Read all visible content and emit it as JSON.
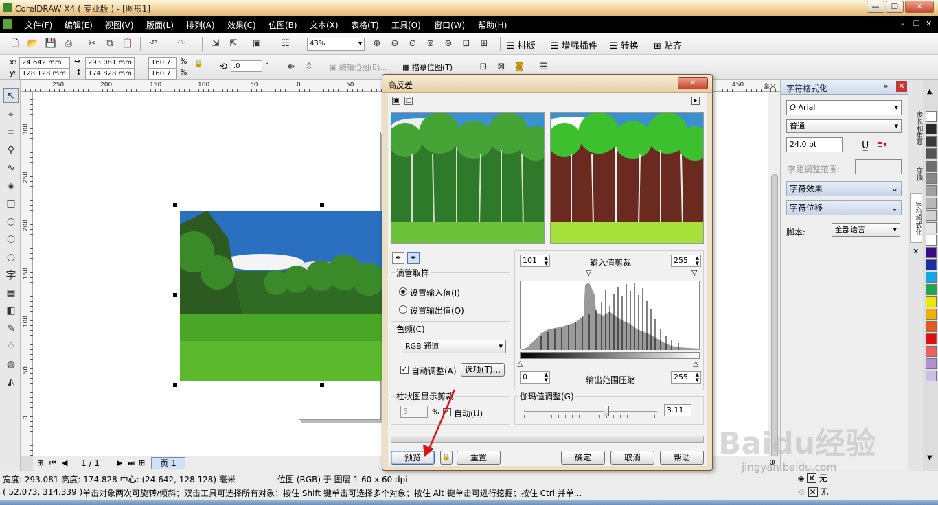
{
  "window": {
    "title": "CorelDRAW X4 ( 专业版 ) - [图形1]"
  },
  "menu": [
    "文件(F)",
    "编辑(E)",
    "视图(V)",
    "版面(L)",
    "排列(A)",
    "效果(C)",
    "位图(B)",
    "文本(X)",
    "表格(T)",
    "工具(O)",
    "窗口(W)",
    "帮助(H)"
  ],
  "toolbar": {
    "zoom": "43%",
    "plugins": [
      "排版",
      "增强插件",
      "转换",
      "贴齐"
    ]
  },
  "props": {
    "x": "24.642 mm",
    "y": "128.128 mm",
    "w": "293.081 mm",
    "h": "174.828 mm",
    "sx": "160.7",
    "sy": "160.7",
    "pct1": "%",
    "pct2": "%",
    "rot": ".0",
    "deg": "°",
    "edit_bitmap": "编辑位图(E)...",
    "trace_bitmap": "描摹位图(T)"
  },
  "hruler_ticks": [
    "250",
    "200",
    "150",
    "100",
    "50",
    "0",
    "50",
    "450",
    "毫米"
  ],
  "vruler_ticks": [
    "300",
    "250",
    "200",
    "150",
    "100",
    "50",
    "0"
  ],
  "page_nav": {
    "count": "1 / 1",
    "tab": "页 1"
  },
  "status": {
    "line1_left": "宽度: 293.081 高度: 174.828 中心: (24.642, 128.128) 毫米",
    "line1_mid": "位图 (RGB) 于 图层 1 60 x 60 dpi",
    "coords": "( 52.073, 314.339 )",
    "hint": "单击对象两次可旋转/倾斜；双击工具可选择所有对象；按住 Shift 键单击可选择多个对象；按住 Alt 键单击可进行挖掘；按住 Ctrl 并单...",
    "fill_none": "无",
    "outline_none": "无"
  },
  "docker": {
    "title": "字符格式化",
    "font": "Arial",
    "style": "普通",
    "size": "24.0 pt",
    "kerning_label": "字距调整范围:",
    "effects": "字符效果",
    "shift": "字符位移",
    "script_label": "脚本:",
    "script_value": "全部语言"
  },
  "vtabs": [
    "步长和重复",
    "变换",
    "字符格式化"
  ],
  "palette": [
    "#ffffff",
    "#2a2a2a",
    "#3a3a3a",
    "#555555",
    "#6e6e6e",
    "#888888",
    "#a0a0a0",
    "#b8b8b8",
    "#d0d0d0",
    "#e8e8e8",
    "#ffffff",
    "#3a0a8a",
    "#1b2fa0",
    "#0fa8e0",
    "#19a84a",
    "#e8e800",
    "#f0b000",
    "#e8581a",
    "#e01010",
    "#e86060",
    "#b090d0",
    "#c8c0e8"
  ],
  "dialog": {
    "title": "高反差",
    "eyedropper_group": "滴管取样",
    "set_input": "设置输入值(I)",
    "set_output": "设置输出值(O)",
    "channel_label": "色频(C)",
    "channel_value": "RGB 通道",
    "auto_adjust": "自动调整(A)",
    "options": "选项(T)...",
    "histogram_clip": "柱状图显示剪裁",
    "clip_value": "5",
    "clip_pct": "%",
    "auto": "自动(U)",
    "input_low": "101",
    "input_label": "输入值剪裁",
    "input_high": "255",
    "output_low": "0",
    "output_label": "输出范围压缩",
    "output_high": "255",
    "gamma_label": "伽玛值调整(G)",
    "gamma_value": "3.11",
    "preview": "预览",
    "reset": "重置",
    "ok": "确定",
    "cancel": "取消",
    "help": "帮助"
  },
  "watermark": {
    "brand": "Baidu经验",
    "url": "jingyan.baidu.com"
  }
}
